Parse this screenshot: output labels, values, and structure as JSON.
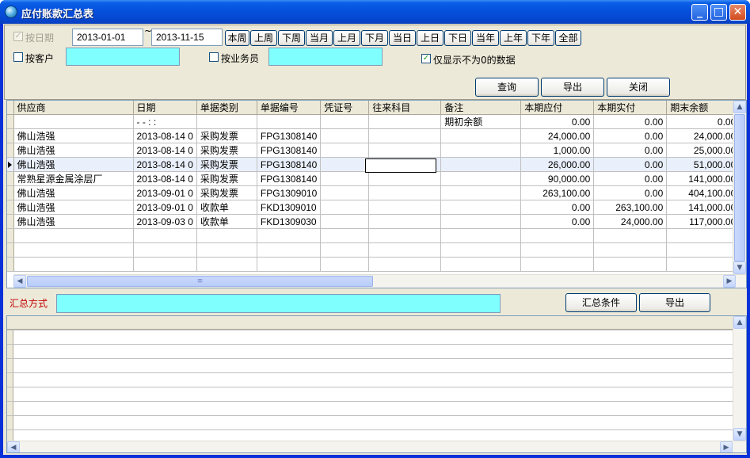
{
  "window": {
    "title": "应付账款汇总表"
  },
  "filters": {
    "by_date_label": "按日期",
    "date_from": "2013-01-01",
    "tilde": "~",
    "date_to": "2013-11-15",
    "by_customer_label": "按客户",
    "by_salesman_label": "按业务员",
    "nonzero_label": "仅显示不为0的数据",
    "quick_buttons": [
      "本周",
      "上周",
      "下周",
      "当月",
      "上月",
      "下月",
      "当日",
      "上日",
      "下日",
      "当年",
      "上年",
      "下年",
      "全部"
    ]
  },
  "actions": {
    "query": "查询",
    "export": "导出",
    "close": "关闭"
  },
  "grid": {
    "columns": [
      "供应商",
      "日期",
      "单据类别",
      "单据编号",
      "凭证号",
      "往来科目",
      "备注",
      "本期应付",
      "本期实付",
      "期末余额"
    ],
    "rows": [
      [
        "",
        "- -   : :",
        "",
        "",
        "",
        "",
        "期初余额",
        "0.00",
        "0.00",
        "0.00"
      ],
      [
        "佛山浩强",
        "2013-08-14 0",
        "采购发票",
        "FPG1308140",
        "",
        "",
        "",
        "24,000.00",
        "0.00",
        "24,000.00"
      ],
      [
        "佛山浩强",
        "2013-08-14 0",
        "采购发票",
        "FPG1308140",
        "",
        "",
        "",
        "1,000.00",
        "0.00",
        "25,000.00"
      ],
      [
        "佛山浩强",
        "2013-08-14 0",
        "采购发票",
        "FPG1308140",
        "",
        "",
        "",
        "26,000.00",
        "0.00",
        "51,000.00"
      ],
      [
        "常熟星源金属涂层厂",
        "2013-08-14 0",
        "采购发票",
        "FPG1308140",
        "",
        "",
        "",
        "90,000.00",
        "0.00",
        "141,000.00"
      ],
      [
        "佛山浩强",
        "2013-09-01 0",
        "采购发票",
        "FPG1309010",
        "",
        "",
        "",
        "263,100.00",
        "0.00",
        "404,100.00"
      ],
      [
        "佛山浩强",
        "2013-09-01 0",
        "收款单",
        "FKD1309010",
        "",
        "",
        "",
        "0.00",
        "263,100.00",
        "141,000.00"
      ],
      [
        "佛山浩强",
        "2013-09-03 0",
        "收款单",
        "FKD1309030",
        "",
        "",
        "",
        "0.00",
        "24,000.00",
        "117,000.00"
      ]
    ]
  },
  "summary": {
    "method_label": "汇总方式",
    "conditions_button": "汇总条件",
    "export_button": "导出"
  },
  "icons": {
    "row_pointer": "row-pointer-icon",
    "up": "▲",
    "down": "▼",
    "left": "◀",
    "right": "▶",
    "grip": "≡",
    "minimize": "_",
    "maximize": "□",
    "close": "✕"
  }
}
